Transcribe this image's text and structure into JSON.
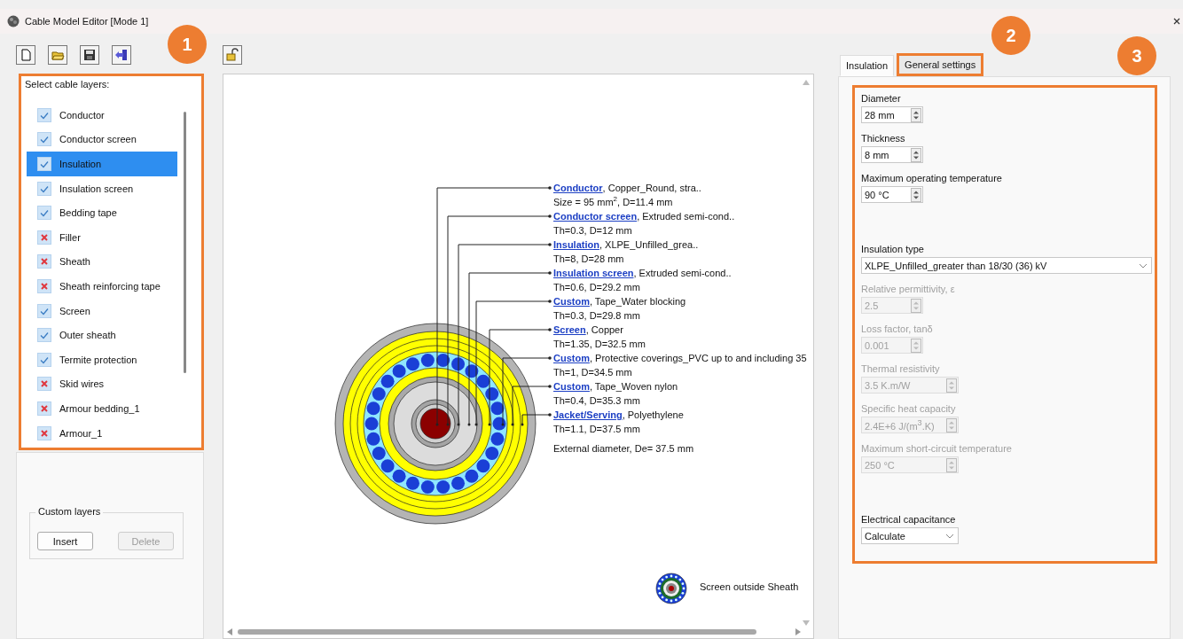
{
  "window": {
    "title": "Cable Model Editor [Mode 1]"
  },
  "callouts": [
    {
      "label": "1"
    },
    {
      "label": "2"
    },
    {
      "label": "3"
    }
  ],
  "layers": {
    "heading": "Select cable layers:",
    "items": [
      {
        "label": "Conductor",
        "checked": true,
        "selected": false
      },
      {
        "label": "Conductor screen",
        "checked": true,
        "selected": false
      },
      {
        "label": "Insulation",
        "checked": true,
        "selected": true
      },
      {
        "label": "Insulation screen",
        "checked": true,
        "selected": false
      },
      {
        "label": "Bedding tape",
        "checked": true,
        "selected": false
      },
      {
        "label": "Filler",
        "checked": false,
        "selected": false
      },
      {
        "label": "Sheath",
        "checked": false,
        "selected": false
      },
      {
        "label": "Sheath reinforcing tape",
        "checked": false,
        "selected": false
      },
      {
        "label": "Screen",
        "checked": true,
        "selected": false
      },
      {
        "label": "Outer sheath",
        "checked": true,
        "selected": false
      },
      {
        "label": "Termite protection",
        "checked": true,
        "selected": false
      },
      {
        "label": "Skid wires",
        "checked": false,
        "selected": false
      },
      {
        "label": "Armour bedding_1",
        "checked": false,
        "selected": false
      },
      {
        "label": "Armour_1",
        "checked": false,
        "selected": false
      }
    ]
  },
  "custom_layers": {
    "title": "Custom layers",
    "buttons": [
      {
        "label": "Insert",
        "disabled": false
      },
      {
        "label": "Delete",
        "disabled": true
      }
    ]
  },
  "diagram": {
    "labels": [
      {
        "link": "Conductor",
        "text": ", Copper_Round, stra..",
        "detail": "Size = 95 mm$^{2}$, D=11.4 mm"
      },
      {
        "link": "Conductor screen",
        "text": ", Extruded semi-cond..",
        "detail": "Th=0.3, D=12 mm"
      },
      {
        "link": "Insulation",
        "text": ", XLPE_Unfilled_grea..",
        "detail": "Th=8, D=28 mm"
      },
      {
        "link": "Insulation screen",
        "text": ", Extruded semi-cond..",
        "detail": "Th=0.6, D=29.2 mm"
      },
      {
        "link": "Custom",
        "text": ", Tape_Water blocking",
        "detail": "Th=0.3, D=29.8 mm"
      },
      {
        "link": "Screen",
        "text": ", Copper",
        "detail": "Th=1.35, D=32.5 mm"
      },
      {
        "link": "Custom",
        "text": ", Protective coverings_PVC up to and including 35",
        "detail": "Th=1, D=34.5 mm"
      },
      {
        "link": "Custom",
        "text": ", Tape_Woven nylon",
        "detail": "Th=0.4, D=35.3 mm"
      },
      {
        "link": "Jacket/Serving",
        "text": ", Polyethylene",
        "detail": "Th=1.1, D=37.5 mm"
      }
    ],
    "external": "External diameter, De= 37.5 mm",
    "legend": "Screen outside Sheath"
  },
  "tabs": [
    {
      "label": "Insulation",
      "selected": true,
      "highlighted": false
    },
    {
      "label": "General settings",
      "selected": false,
      "highlighted": true
    }
  ],
  "fields": [
    {
      "kind": "spin",
      "label": "Diameter",
      "value": "28 mm",
      "disabled": false
    },
    {
      "kind": "spin",
      "label": "Thickness",
      "value": "8 mm",
      "disabled": false
    },
    {
      "kind": "spin",
      "label": "Maximum operating temperature",
      "value": "90 °C",
      "disabled": false
    },
    {
      "kind": "combo",
      "label": "Insulation type",
      "value": "XLPE_Unfilled_greater than 18/30 (36) kV",
      "disabled": false
    },
    {
      "kind": "spin",
      "label": "Relative permittivity, ε",
      "value": "2.5",
      "disabled": true
    },
    {
      "kind": "spin",
      "label": "Loss factor, tanδ",
      "value": "0.001",
      "disabled": true
    },
    {
      "kind": "longspin",
      "label": "Thermal resistivity",
      "value": "3.5 K.m/W",
      "disabled": true
    },
    {
      "kind": "longspin",
      "label": "Specific heat capacity",
      "value": "2.4E+6 J/(m$^{3}$.K)",
      "disabled": true
    },
    {
      "kind": "longspin",
      "label": "Maximum short-circuit temperature",
      "value": "250 °C",
      "disabled": true
    },
    {
      "kind": "shortcombo",
      "label": "Electrical capacitance",
      "value": "Calculate",
      "disabled": false
    }
  ]
}
